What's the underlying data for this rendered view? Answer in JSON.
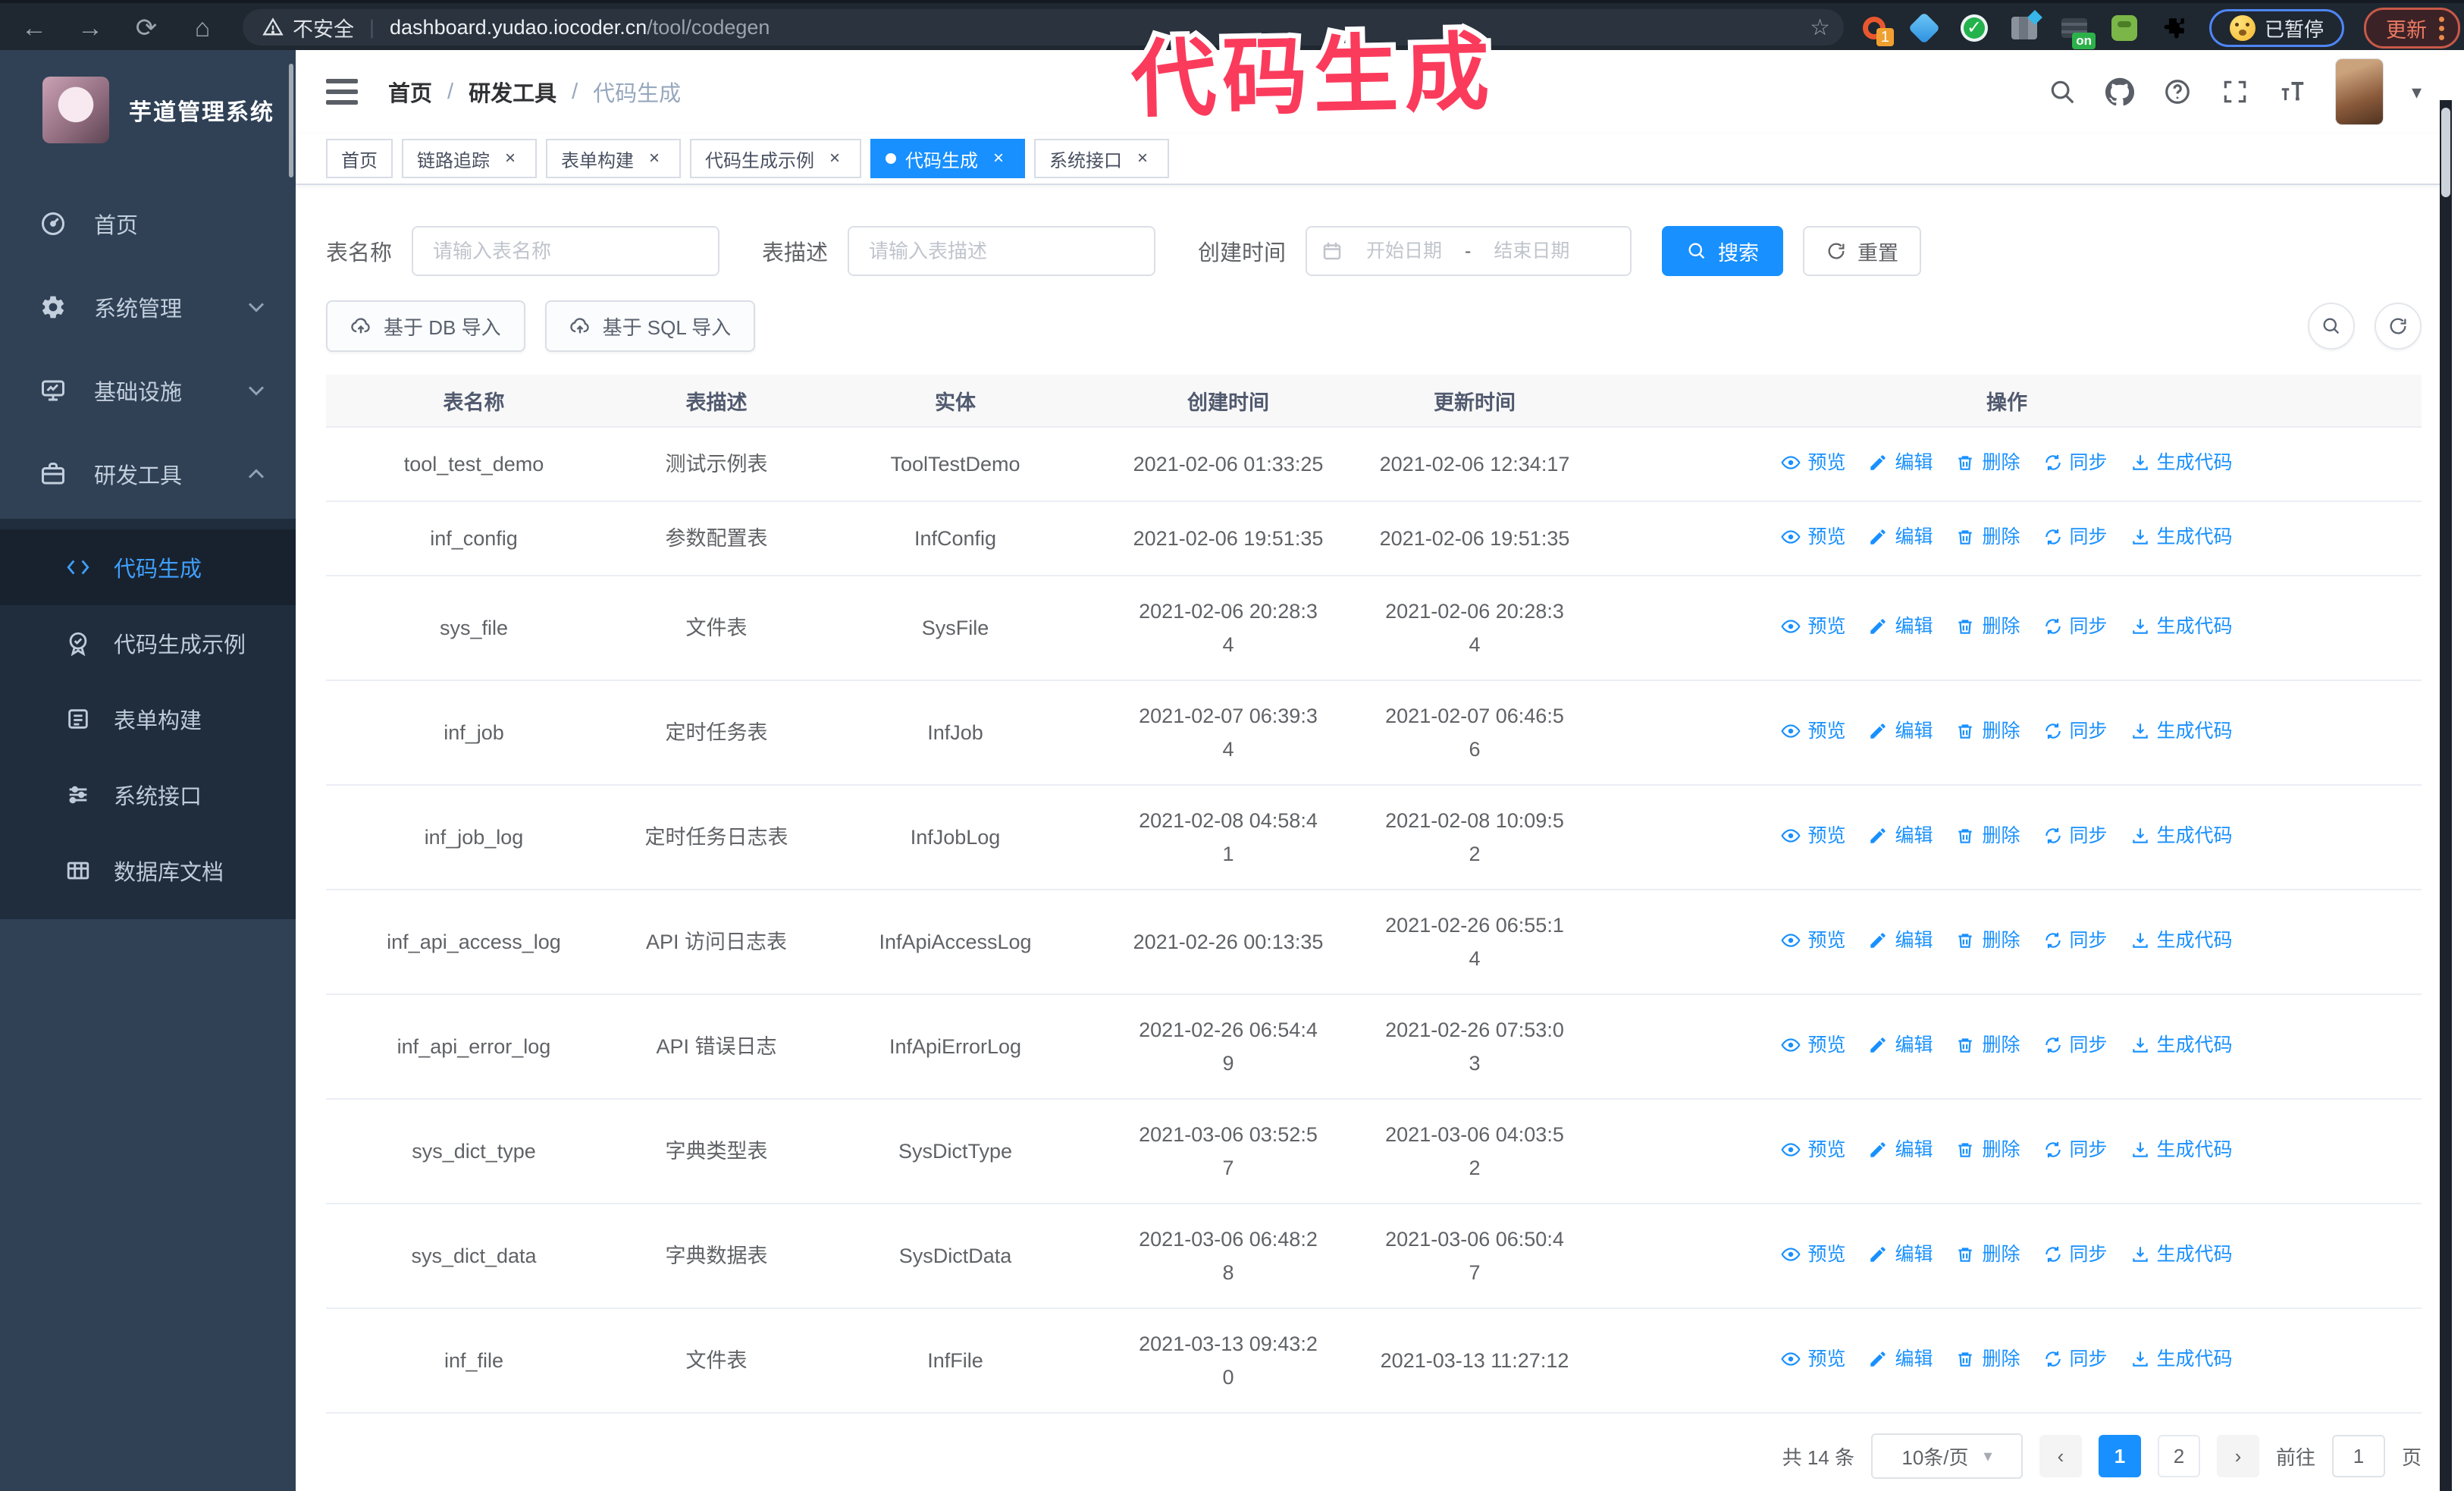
{
  "browser": {
    "security_label": "不安全",
    "url_host": "dashboard.yudao.iocoder.cn",
    "url_path": "/tool/codegen",
    "ext_badge": "1",
    "ext_on_badge": "on",
    "paused_label": "已暂停",
    "update_label": "更新"
  },
  "annotation": {
    "text": "代码生成",
    "color": "#fb3b5c"
  },
  "sidebar": {
    "title": "芋道管理系统",
    "items": [
      {
        "label": "首页",
        "icon": "dashboard-icon"
      },
      {
        "label": "系统管理",
        "icon": "gear-icon"
      },
      {
        "label": "基础设施",
        "icon": "monitor-icon"
      },
      {
        "label": "研发工具",
        "icon": "toolbox-icon"
      }
    ],
    "submenu": [
      {
        "label": "代码生成",
        "icon": "code-icon",
        "active": true
      },
      {
        "label": "代码生成示例",
        "icon": "badge-check-icon",
        "active": false
      },
      {
        "label": "表单构建",
        "icon": "form-icon",
        "active": false
      },
      {
        "label": "系统接口",
        "icon": "sliders-icon",
        "active": false
      },
      {
        "label": "数据库文档",
        "icon": "table-grid-icon",
        "active": false
      }
    ]
  },
  "header": {
    "breadcrumb": [
      "首页",
      "研发工具",
      "代码生成"
    ],
    "separator": "/"
  },
  "tabs": [
    {
      "label": "首页",
      "closable": false,
      "active": false
    },
    {
      "label": "链路追踪",
      "closable": true,
      "active": false
    },
    {
      "label": "表单构建",
      "closable": true,
      "active": false
    },
    {
      "label": "代码生成示例",
      "closable": true,
      "active": false
    },
    {
      "label": "代码生成",
      "closable": true,
      "active": true
    },
    {
      "label": "系统接口",
      "closable": true,
      "active": false
    }
  ],
  "filters": {
    "name_label": "表名称",
    "name_placeholder": "请输入表名称",
    "desc_label": "表描述",
    "desc_placeholder": "请输入表描述",
    "time_label": "创建时间",
    "start_placeholder": "开始日期",
    "date_separator": "-",
    "end_placeholder": "结束日期",
    "search_label": "搜索",
    "reset_label": "重置"
  },
  "toolbar": {
    "import_db_label": "基于 DB 导入",
    "import_sql_label": "基于 SQL 导入"
  },
  "table": {
    "columns": [
      "表名称",
      "表描述",
      "实体",
      "创建时间",
      "更新时间",
      "操作"
    ],
    "actions": [
      {
        "name": "preview",
        "label": "预览",
        "icon": "eye-icon"
      },
      {
        "name": "edit",
        "label": "编辑",
        "icon": "edit-icon"
      },
      {
        "name": "delete",
        "label": "删除",
        "icon": "delete-icon"
      },
      {
        "name": "sync",
        "label": "同步",
        "icon": "sync-icon"
      },
      {
        "name": "generate",
        "label": "生成代码",
        "icon": "download-icon"
      }
    ],
    "rows": [
      {
        "name": "tool_test_demo",
        "desc": "测试示例表",
        "entity": "ToolTestDemo",
        "created": "2021-02-06 01:33:25",
        "updated": "2021-02-06 12:34:17"
      },
      {
        "name": "inf_config",
        "desc": "参数配置表",
        "entity": "InfConfig",
        "created": "2021-02-06 19:51:35",
        "updated": "2021-02-06 19:51:35"
      },
      {
        "name": "sys_file",
        "desc": "文件表",
        "entity": "SysFile",
        "created": "2021-02-06 20:28:3\n4",
        "updated": "2021-02-06 20:28:3\n4"
      },
      {
        "name": "inf_job",
        "desc": "定时任务表",
        "entity": "InfJob",
        "created": "2021-02-07 06:39:3\n4",
        "updated": "2021-02-07 06:46:5\n6"
      },
      {
        "name": "inf_job_log",
        "desc": "定时任务日志表",
        "entity": "InfJobLog",
        "created": "2021-02-08 04:58:4\n1",
        "updated": "2021-02-08 10:09:5\n2"
      },
      {
        "name": "inf_api_access_log",
        "desc": "API 访问日志表",
        "entity": "InfApiAccessLog",
        "created": "2021-02-26 00:13:35",
        "updated": "2021-02-26 06:55:1\n4"
      },
      {
        "name": "inf_api_error_log",
        "desc": "API 错误日志",
        "entity": "InfApiErrorLog",
        "created": "2021-02-26 06:54:4\n9",
        "updated": "2021-02-26 07:53:0\n3"
      },
      {
        "name": "sys_dict_type",
        "desc": "字典类型表",
        "entity": "SysDictType",
        "created": "2021-03-06 03:52:5\n7",
        "updated": "2021-03-06 04:03:5\n2"
      },
      {
        "name": "sys_dict_data",
        "desc": "字典数据表",
        "entity": "SysDictData",
        "created": "2021-03-06 06:48:2\n8",
        "updated": "2021-03-06 06:50:4\n7"
      },
      {
        "name": "inf_file",
        "desc": "文件表",
        "entity": "InfFile",
        "created": "2021-03-13 09:43:2\n0",
        "updated": "2021-03-13 11:27:12"
      }
    ]
  },
  "pagination": {
    "total_label": "共 14 条",
    "size_value": "10条/页",
    "pages": [
      "1",
      "2"
    ],
    "active_page": "1",
    "goto_label": "前往",
    "goto_value": "1",
    "page_suffix": "页"
  },
  "colors": {
    "accent_blue": "#1890ff",
    "sidebar_bg": "#304156",
    "submenu_bg": "#1f2d3d",
    "chrome_bg": "#1f2731",
    "annotation_pink": "#fb3b5c"
  }
}
